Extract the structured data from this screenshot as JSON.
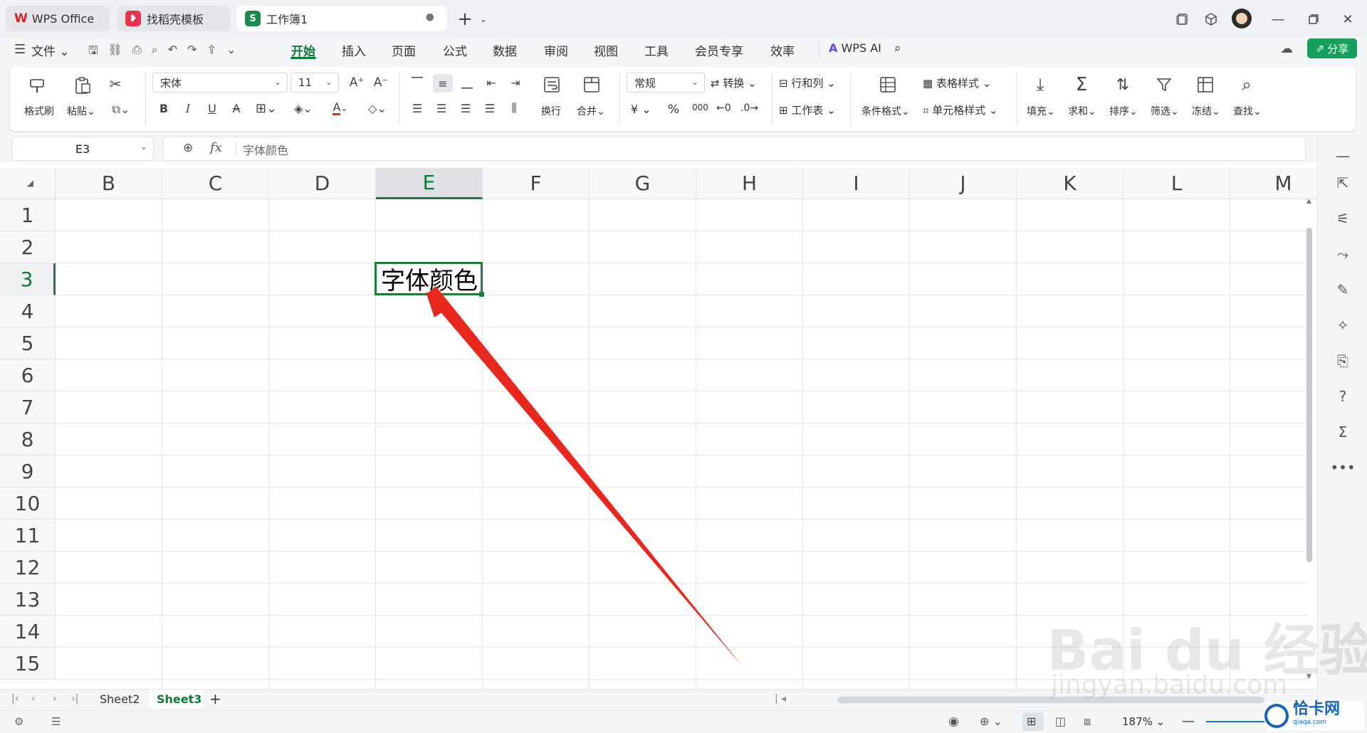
{
  "tabs": [
    {
      "label": "WPS Office",
      "icon": "wps-logo-icon"
    },
    {
      "label": "找稻壳模板",
      "icon": "docer-logo-icon"
    },
    {
      "label": "工作簿1",
      "icon": "spreadsheet-logo-icon"
    }
  ],
  "menu": {
    "file": "文件",
    "items": [
      "开始",
      "插入",
      "页面",
      "公式",
      "数据",
      "审阅",
      "视图",
      "工具",
      "会员专享",
      "效率"
    ],
    "active": "开始",
    "wps_ai": "WPS AI",
    "share": "分享"
  },
  "ribbon": {
    "format_painter": "格式刷",
    "paste": "粘贴",
    "font_name": "宋体",
    "font_size": "11",
    "wrap": "换行",
    "merge": "合并",
    "number_format": "常规",
    "convert": "转换",
    "rows_cols": "行和列",
    "worksheet": "工作表",
    "conditional_format": "条件格式",
    "table_style": "表格样式",
    "cell_style": "单元格样式",
    "fill": "填充",
    "sum": "求和",
    "sort": "排序",
    "filter": "筛选",
    "freeze": "冻结",
    "find": "查找",
    "currency": "¥",
    "percent": "%",
    "thousands": "000"
  },
  "formula_bar": {
    "name_box": "E3",
    "fx": "fx",
    "content": "字体颜色"
  },
  "grid": {
    "columns": [
      "B",
      "C",
      "D",
      "E",
      "F",
      "G",
      "H",
      "I",
      "J",
      "K",
      "L",
      "M"
    ],
    "rows": [
      "1",
      "2",
      "3",
      "4",
      "5",
      "6",
      "7",
      "8",
      "9",
      "10",
      "11",
      "12",
      "13",
      "14",
      "15"
    ],
    "selected_col": "E",
    "selected_row": "3",
    "cell_e3": "字体颜色"
  },
  "sheets": {
    "tabs": [
      "Sheet2",
      "Sheet3"
    ],
    "active": "Sheet3",
    "add": "+"
  },
  "status": {
    "zoom": "187%"
  },
  "watermark": {
    "brand": "Bai du 经验",
    "url": "jingyan.baidu.com",
    "corner_label": "恰卡网",
    "corner_url": "qiaqa.com"
  },
  "colors": {
    "accent_green": "#0d7a3a",
    "selection_border": "#1e7d3e",
    "arrow_red": "#e8281e",
    "share_button": "#17a05d"
  }
}
